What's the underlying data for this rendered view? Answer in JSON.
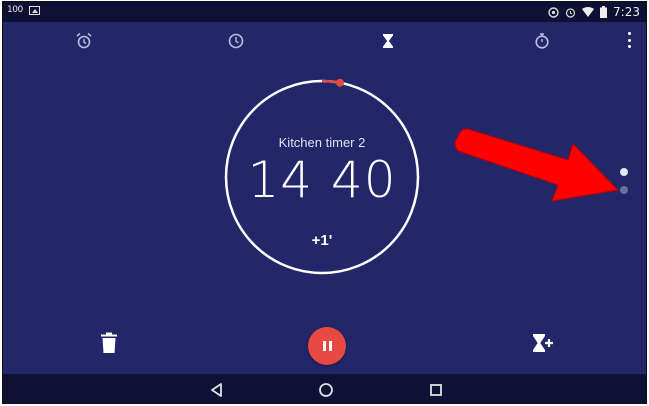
{
  "status_bar": {
    "battery_level": "100",
    "time": "7:23",
    "icons": [
      "image-icon",
      "sync-icon",
      "alarm-icon",
      "wifi-icon",
      "battery-icon"
    ]
  },
  "tabs": [
    {
      "name": "alarm",
      "icon": "alarm-clock-icon",
      "active": false
    },
    {
      "name": "clock",
      "icon": "clock-icon",
      "active": false
    },
    {
      "name": "timer",
      "icon": "hourglass-icon",
      "active": true
    },
    {
      "name": "stopwatch",
      "icon": "stopwatch-icon",
      "active": false
    }
  ],
  "timer": {
    "label": "Kitchen timer 2",
    "minutes": "14",
    "seconds": "40",
    "add_minute_label": "+1'",
    "progress_remaining_fraction": 0.97
  },
  "pager": {
    "pages": 2,
    "current": 1
  },
  "colors": {
    "background": "#23276a",
    "status_bar": "#0e1034",
    "accent": "#e64a43",
    "ring": "#ffffff",
    "annotation_arrow": "#ff0000"
  }
}
